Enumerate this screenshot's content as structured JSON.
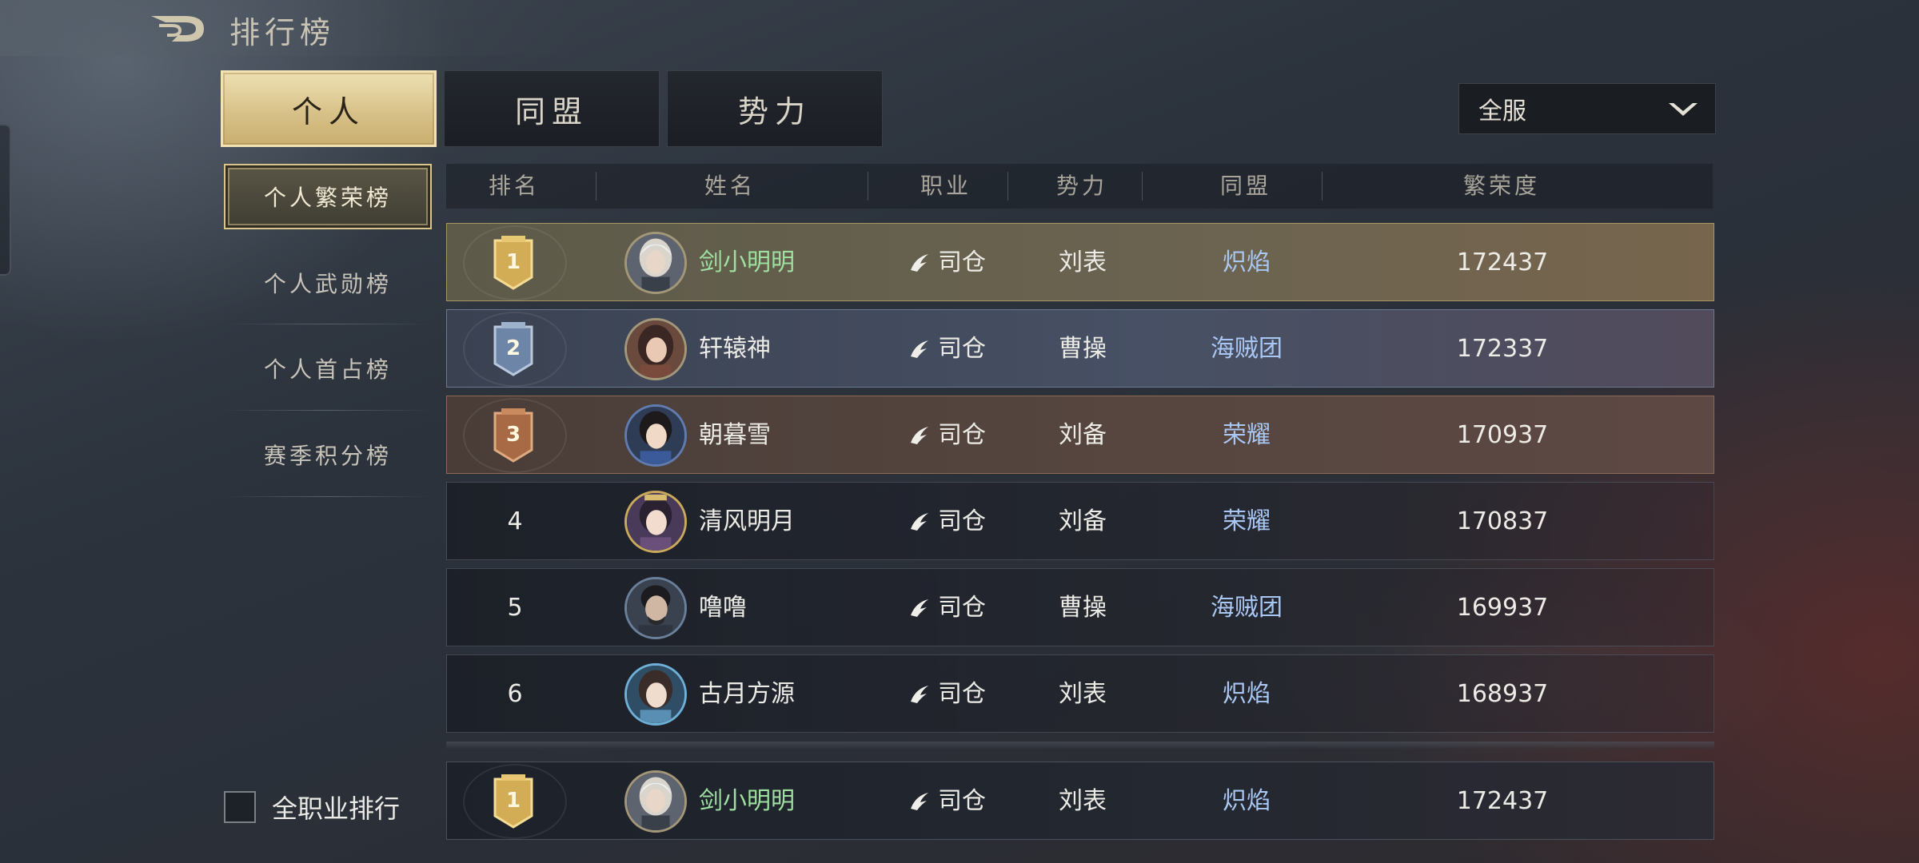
{
  "header": {
    "title": "排行榜"
  },
  "tabs": [
    {
      "label": "个人",
      "active": true
    },
    {
      "label": "同盟",
      "active": false
    },
    {
      "label": "势力",
      "active": false
    }
  ],
  "server_select": {
    "value": "全服"
  },
  "sub_categories": [
    {
      "label": "个人繁荣榜",
      "active": true
    },
    {
      "label": "个人武勋榜",
      "active": false
    },
    {
      "label": "个人首占榜",
      "active": false
    },
    {
      "label": "赛季积分榜",
      "active": false
    }
  ],
  "table": {
    "columns": [
      "排名",
      "姓名",
      "职业",
      "势力",
      "同盟",
      "繁荣度"
    ],
    "rows": [
      {
        "rank": "1",
        "name": "剑小明明",
        "job": "司仓",
        "faction": "刘表",
        "alliance": "炽焰",
        "prosperity": "172437"
      },
      {
        "rank": "2",
        "name": "轩辕神",
        "job": "司仓",
        "faction": "曹操",
        "alliance": "海贼团",
        "prosperity": "172337"
      },
      {
        "rank": "3",
        "name": "朝暮雪",
        "job": "司仓",
        "faction": "刘备",
        "alliance": "荣耀",
        "prosperity": "170937"
      },
      {
        "rank": "4",
        "name": "清风明月",
        "job": "司仓",
        "faction": "刘备",
        "alliance": "荣耀",
        "prosperity": "170837"
      },
      {
        "rank": "5",
        "name": "噜噜",
        "job": "司仓",
        "faction": "曹操",
        "alliance": "海贼团",
        "prosperity": "169937"
      },
      {
        "rank": "6",
        "name": "古月方源",
        "job": "司仓",
        "faction": "刘表",
        "alliance": "炽焰",
        "prosperity": "168937"
      }
    ],
    "my_row": {
      "rank": "1",
      "name": "剑小明明",
      "job": "司仓",
      "faction": "刘表",
      "alliance": "炽焰",
      "prosperity": "172437"
    }
  },
  "all_job_toggle": {
    "label": "全职业排行",
    "checked": false
  },
  "colors": {
    "gold": "#d8c28a",
    "alliance_text": "#a9c7f3",
    "self_name": "#9fe0a0"
  }
}
